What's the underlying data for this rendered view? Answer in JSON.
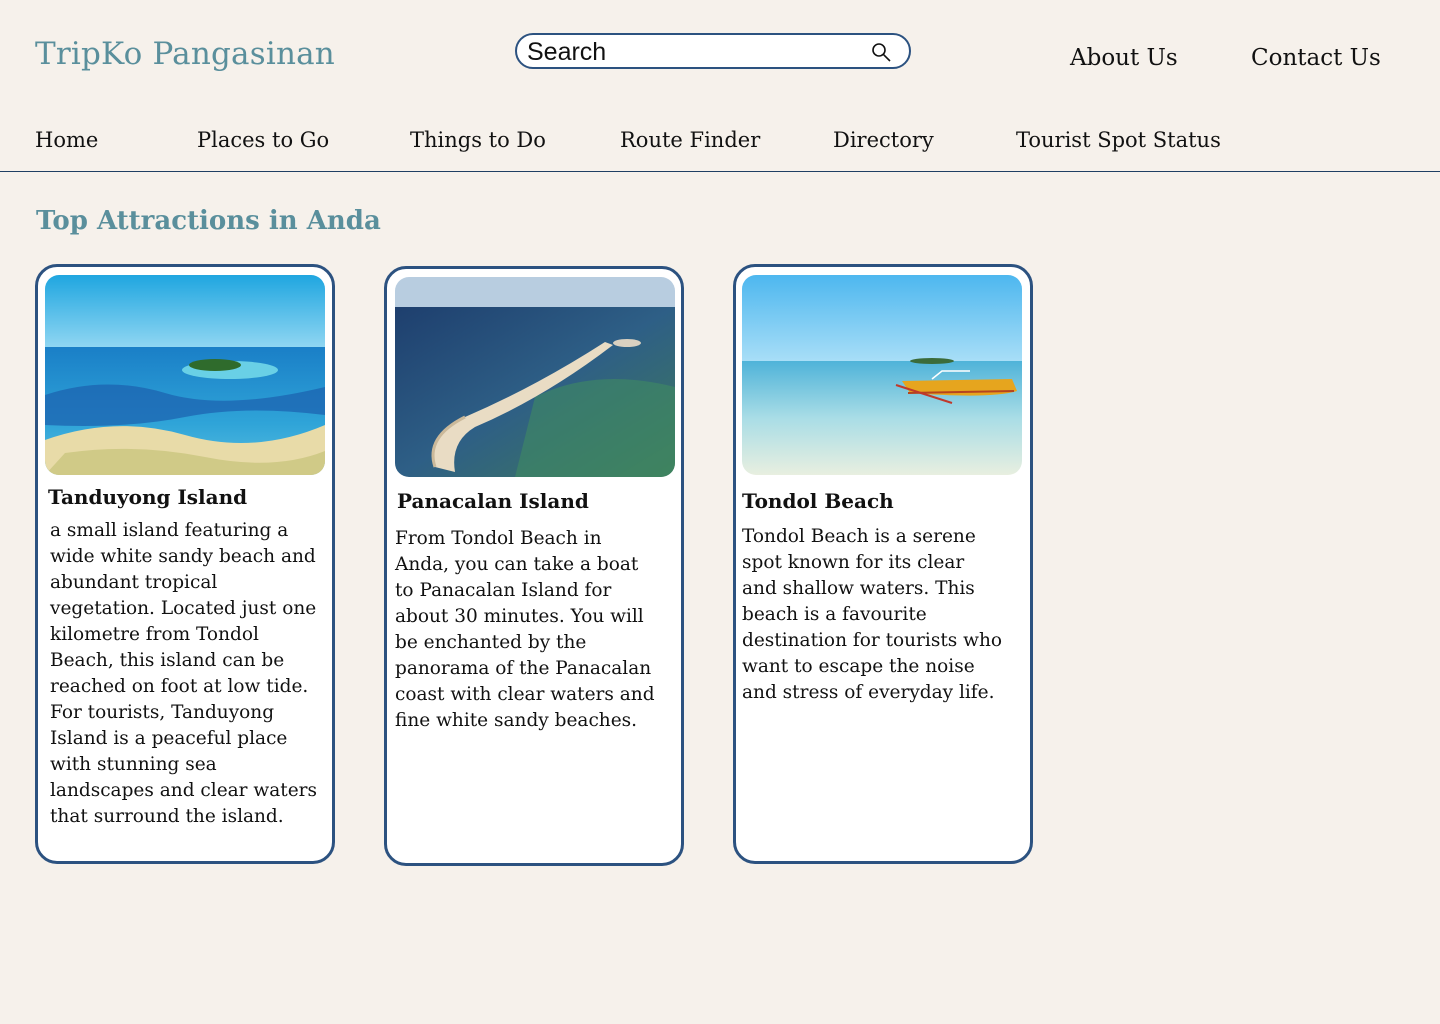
{
  "header": {
    "brand": "TripKo Pangasinan",
    "search": {
      "placeholder": "Search"
    },
    "links": {
      "about": "About Us",
      "contact": "Contact Us"
    }
  },
  "nav": {
    "items": [
      "Home",
      "Places to Go",
      "Things to Do",
      "Route Finder",
      "Directory",
      "Tourist Spot Status"
    ]
  },
  "section": {
    "title": "Top Attractions in Anda"
  },
  "cards": [
    {
      "title": "Tanduyong Island",
      "description": "a small island featuring a wide white sandy beach and abundant tropical vegetation. Located just one kilometre from Tondol Beach, this island can be reached on foot at low tide. For tourists, Tanduyong Island is a peaceful place with stunning sea landscapes and clear waters that surround the island."
    },
    {
      "title": "Panacalan Island",
      "description": "From Tondol Beach in Anda, you can take a boat to Panacalan Island for about 30 minutes. You will be enchanted by the panorama of the Panacalan coast with clear waters and fine white sandy beaches."
    },
    {
      "title": "Tondol Beach",
      "description": "Tondol Beach is a serene spot known for its clear and shallow waters. This beach is a favourite destination for tourists who want to escape the noise and stress of everyday life."
    }
  ],
  "colors": {
    "accent": "#5a8f9c",
    "border": "#2c5280",
    "background": "#f6f1eb"
  }
}
